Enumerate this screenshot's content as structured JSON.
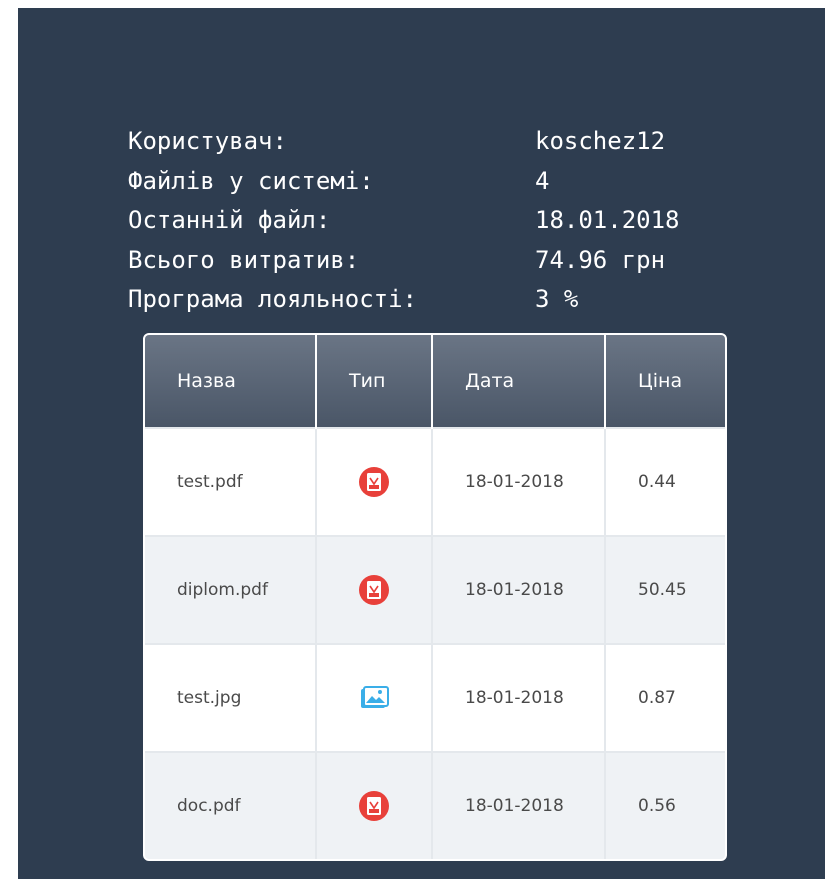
{
  "summary": [
    {
      "label": "Користувач:",
      "value": "koschez12"
    },
    {
      "label": "Файлів у системі:",
      "value": "4"
    },
    {
      "label": "Останній файл:",
      "value": "18.01.2018"
    },
    {
      "label": "Всього витратив:",
      "value": "74.96 грн"
    },
    {
      "label": "Програма лояльності:",
      "value": "3 %"
    }
  ],
  "table": {
    "headers": [
      "Назва",
      "Тип",
      "Дата",
      "Ціна"
    ],
    "rows": [
      {
        "name": "test.pdf",
        "type_icon": "pdf-icon",
        "date": "18-01-2018",
        "price": "0.44"
      },
      {
        "name": "diplom.pdf",
        "type_icon": "pdf-icon",
        "date": "18-01-2018",
        "price": "50.45"
      },
      {
        "name": "test.jpg",
        "type_icon": "image-icon",
        "date": "18-01-2018",
        "price": "0.87"
      },
      {
        "name": "doc.pdf",
        "type_icon": "pdf-icon",
        "date": "18-01-2018",
        "price": "0.56"
      }
    ]
  },
  "colors": {
    "panel_bg": "#2e3d50",
    "pdf_red": "#e8403a",
    "image_blue": "#3aaee8"
  }
}
